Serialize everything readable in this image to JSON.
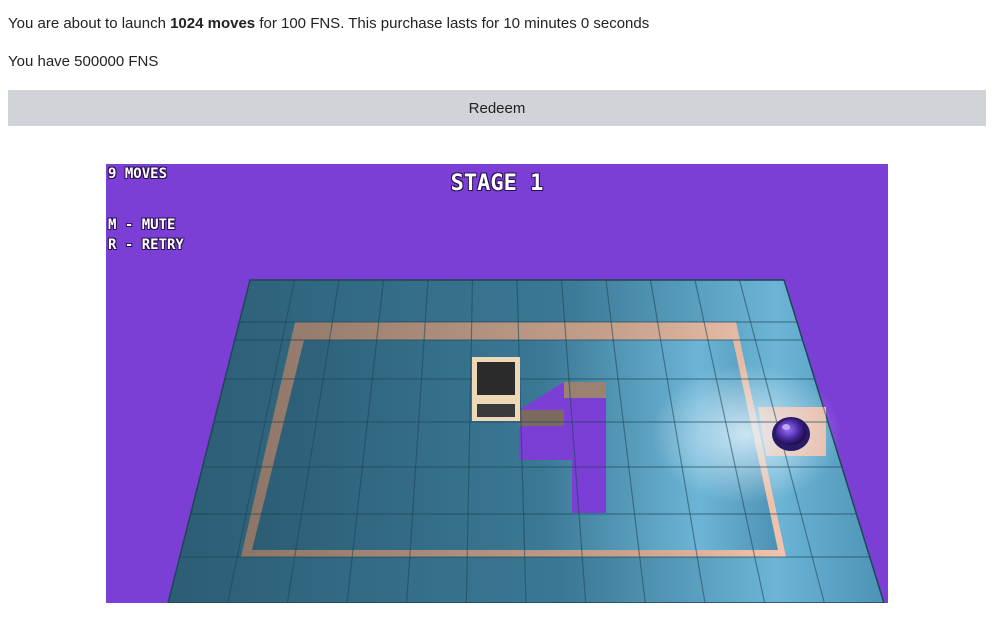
{
  "purchase": {
    "prefix": "You are about to launch ",
    "moves_label": "1024 moves",
    "suffix": " for 100 FNS. This purchase lasts for 10 minutes 0 seconds"
  },
  "balance": {
    "text": "You have 500000 FNS"
  },
  "redeem": {
    "label": "Redeem"
  },
  "game": {
    "moves_counter": "9 MOVES",
    "stage_title": "STAGE 1",
    "controls": [
      "M - MUTE",
      "R - RETRY"
    ],
    "colors": {
      "background": "#7b3fd6",
      "tile": "#3f7d9c",
      "tile_highlight": "#72c4ea",
      "trench": "#c09a84",
      "block": "#2b2b2b",
      "ball": "#4a2aa0"
    }
  }
}
